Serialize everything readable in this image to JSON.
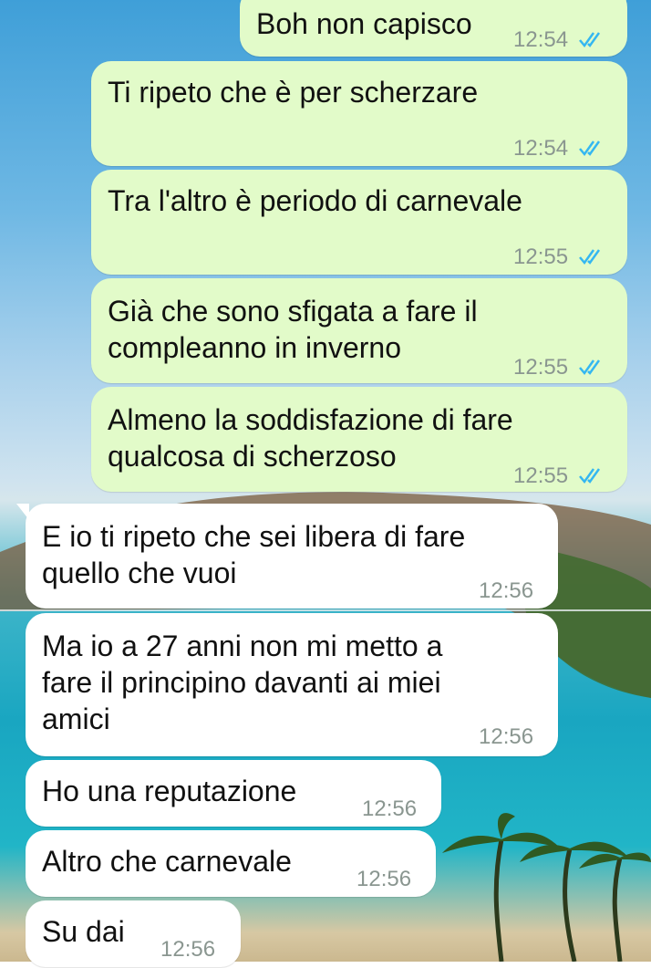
{
  "messages": [
    {
      "text": "Boh non capisco",
      "time": "12:54",
      "dir": "out",
      "read": true
    },
    {
      "text": "Ti ripeto che è per scherzare",
      "time": "12:54",
      "dir": "out",
      "read": true
    },
    {
      "text": "Tra l'altro è periodo di carnevale",
      "time": "12:55",
      "dir": "out",
      "read": true
    },
    {
      "text": "Già che sono sfigata a fare il\ncompleanno in inverno",
      "time": "12:55",
      "dir": "out",
      "read": true
    },
    {
      "text": "Almeno la soddisfazione di fare\nqualcosa di scherzoso",
      "time": "12:55",
      "dir": "out",
      "read": true
    },
    {
      "text": "E io ti ripeto che sei libera di fare\nquello che vuoi",
      "time": "12:56",
      "dir": "in"
    },
    {
      "text": "Ma io a 27 anni non mi metto a\nfare il principino davanti ai miei\namici",
      "time": "12:56",
      "dir": "in"
    },
    {
      "text": "Ho una reputazione",
      "time": "12:56",
      "dir": "in"
    },
    {
      "text": "Altro che carnevale",
      "time": "12:56",
      "dir": "in"
    },
    {
      "text": "Su dai",
      "time": "12:56",
      "dir": "in"
    }
  ],
  "colors": {
    "outgoing": "#e2fbc9",
    "incoming": "#ffffff",
    "read_ticks": "#34b7f1"
  },
  "icons": {
    "read": "double-check-icon"
  }
}
